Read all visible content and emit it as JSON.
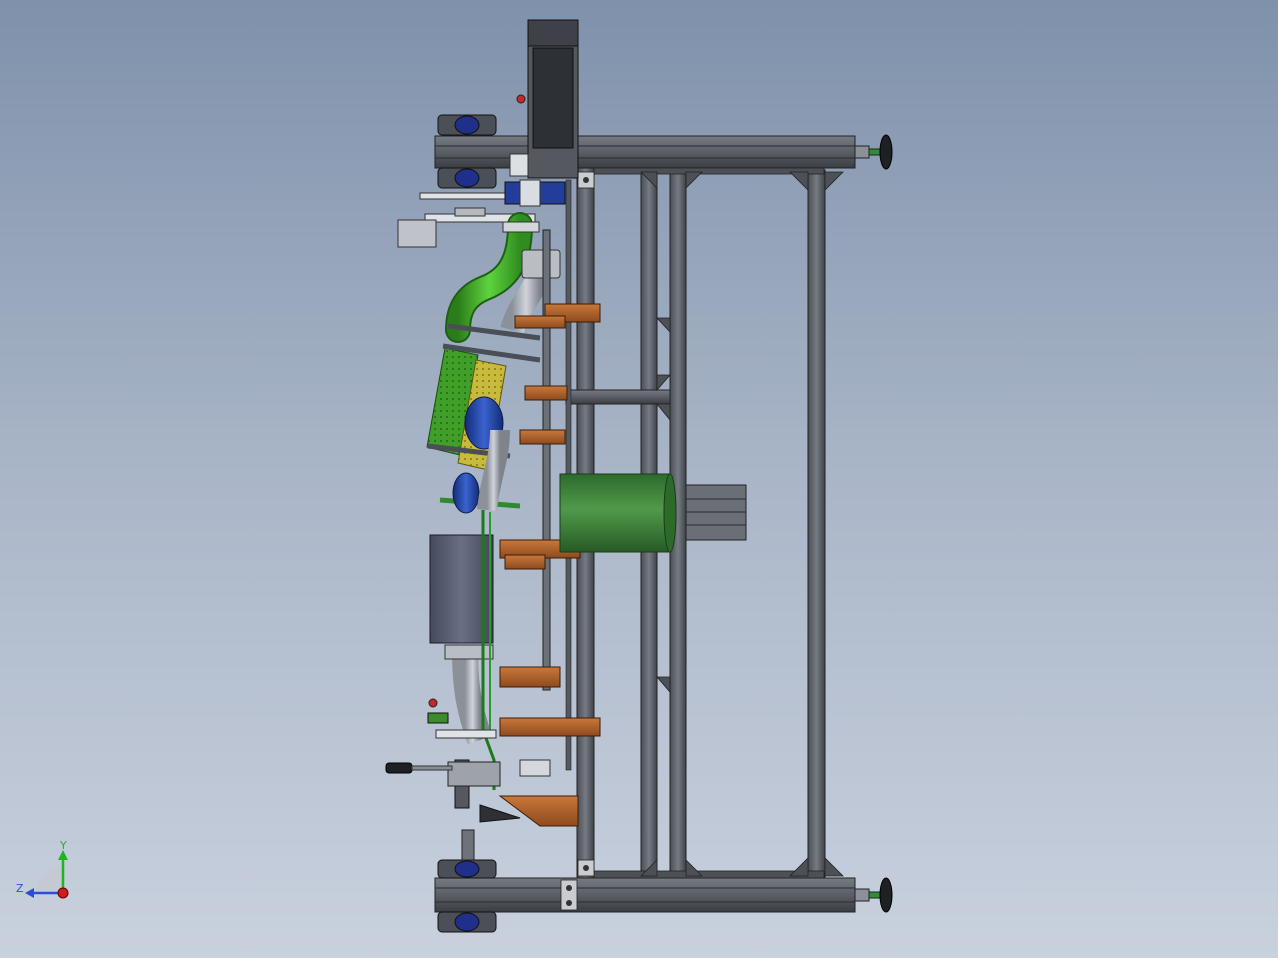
{
  "triad": {
    "y_label": "Y",
    "z_label": "Z"
  },
  "colors": {
    "background_top": "#7f91ab",
    "background_bottom": "#c9d1de",
    "frame_steel": "#5c6168",
    "frame_dark": "#34373c",
    "bracket_copper": "#b4652e",
    "green_pipe": "#3fa52a",
    "green_drum": "#3e7b3a",
    "blue_part": "#1f3f9e",
    "yellow_part": "#c2b234",
    "motor_box": "#5b5f73",
    "y_axis": "#1fb51f",
    "z_axis": "#2a4fd6",
    "x_axis_dot": "#d01c1c"
  },
  "icons": {
    "triad": "coordinate-triad-icon",
    "handwheel": "handwheel-icon",
    "leveling_foot": "leveling-foot-icon"
  }
}
